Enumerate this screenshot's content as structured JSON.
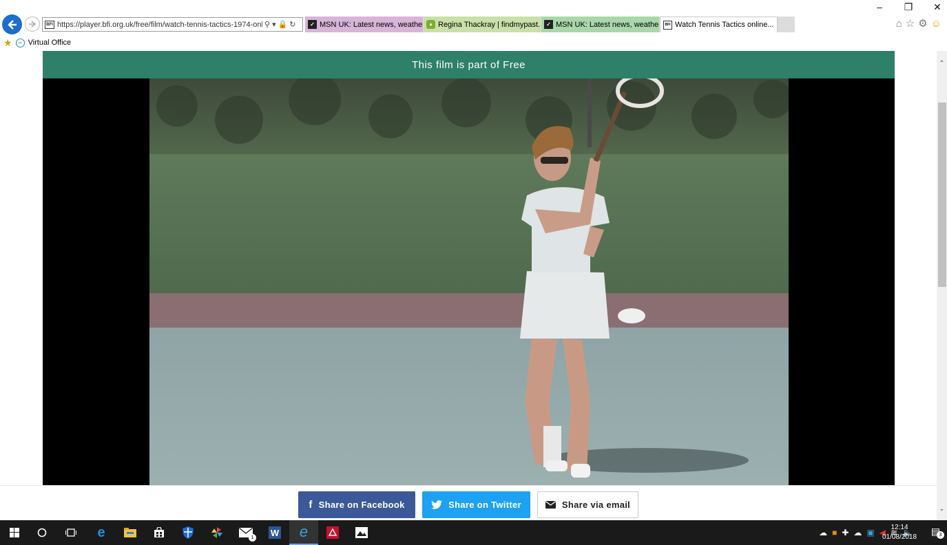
{
  "browser": {
    "url": "https://player.bfi.org.uk/free/film/watch-tennis-tactics-1974-onli",
    "favorites": [
      {
        "label": "Virtual Office"
      }
    ],
    "tabs": [
      {
        "label": "MSN UK: Latest news, weather,...",
        "color": "#d8b4d9"
      },
      {
        "label": "Regina Thackray | findmypast....",
        "color": "#c9e0a8"
      },
      {
        "label": "MSN UK: Latest news, weather,...",
        "color": "#a9d7a9"
      },
      {
        "label": "Watch Tennis Tactics online...",
        "active": true
      }
    ]
  },
  "page": {
    "banner_text": "This film is part of Free",
    "share": {
      "facebook_label": "Share on Facebook",
      "twitter_label": "Share on Twitter",
      "email_label": "Share via email"
    }
  },
  "taskbar": {
    "time": "12:14",
    "date": "01/08/2018",
    "mail_count": "1",
    "notification_count": "3"
  },
  "colors": {
    "banner": "#2e8068",
    "facebook": "#3b5998",
    "twitter": "#1da1f2"
  }
}
